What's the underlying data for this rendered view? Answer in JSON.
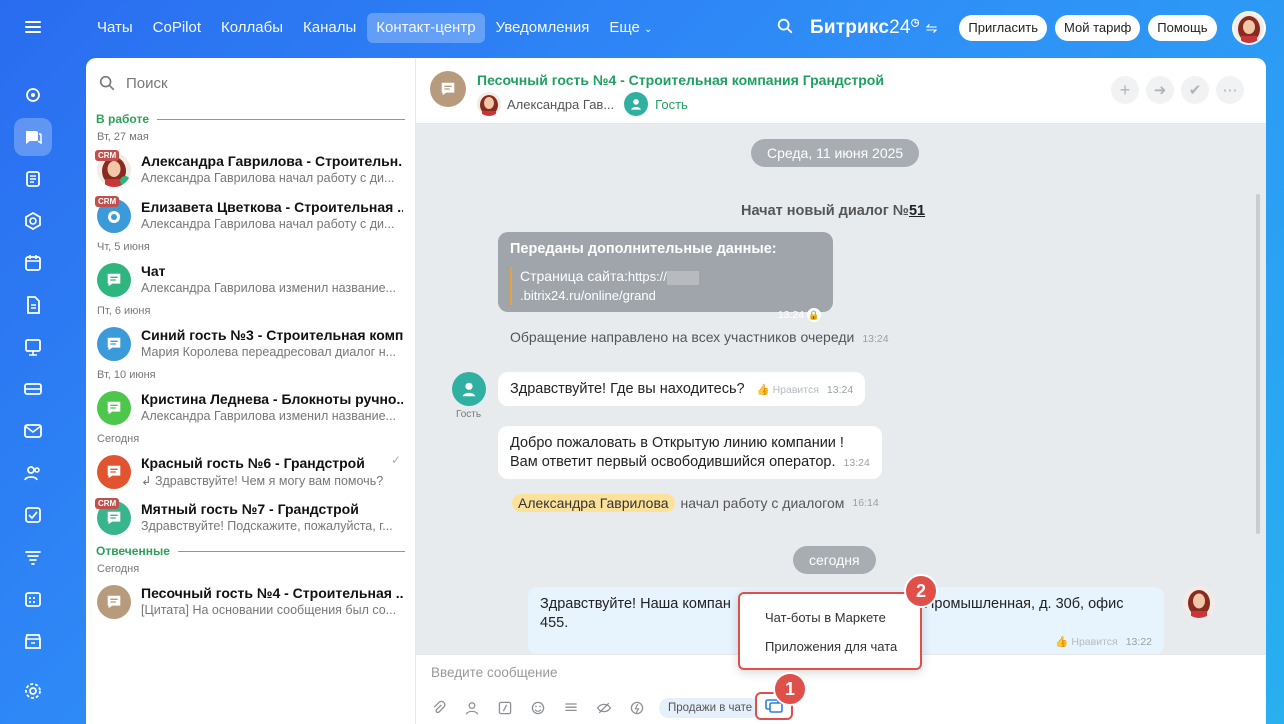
{
  "topnav": {
    "items": [
      "Чаты",
      "CoPilot",
      "Коллабы",
      "Каналы",
      "Контакт-центр",
      "Уведомления",
      "Еще"
    ],
    "active": "Контакт-центр"
  },
  "brand": {
    "name": "Битрикс",
    "num": "24"
  },
  "header_buttons": {
    "invite": "Пригласить",
    "tariff": "Мой тариф",
    "help": "Помощь"
  },
  "search": {
    "placeholder": "Поиск"
  },
  "list": {
    "section_work": "В работе",
    "section_answered": "Отвеченные",
    "dates": [
      "Вт, 27 мая",
      "Чт, 5 июня",
      "Пт, 6 июня",
      "Вт, 10 июня",
      "Сегодня",
      "Сегодня"
    ],
    "crm": "CRM",
    "items": [
      {
        "title": "Александра Гаврилова - Строительн...",
        "msg": "Александра Гаврилова начал работу с ди...",
        "color": "#ffffff"
      },
      {
        "title": "Елизавета Цветкова - Строительная ...",
        "msg": "Александра Гаврилова начал работу с ди...",
        "color": "#3b9ad9"
      },
      {
        "title": "Чат",
        "msg": "Александра Гаврилова изменил название...",
        "color": "#2fb57f"
      },
      {
        "title": "Синий гость №3 - Строительная комп...",
        "msg": "Мария Королева переадресовал диалог н...",
        "color": "#3b9ad9"
      },
      {
        "title": "Кристина Леднева - Блокноты ручно...",
        "msg": "Александра Гаврилова изменил название...",
        "color": "#4cc74c"
      },
      {
        "title": "Красный гость №6 - Грандстрой",
        "msg": "Здравствуйте! Чем я могу вам помочь?",
        "color": "#e2532f"
      },
      {
        "title": "Мятный гость №7 - Грандстрой",
        "msg": "Здравствуйте! Подскажите, пожалуйста, г...",
        "color": "#38b58c"
      },
      {
        "title": "Песочный гость №4 - Строительная ...",
        "msg": "[Цитата] На основании сообщения был со...",
        "color": "#b89a7c"
      }
    ]
  },
  "chat": {
    "title": "Песочный гость №4 - Строительная компания Грандстрой",
    "operator": "Александра Гав...",
    "guest": "Гость",
    "date1": "Среда, 11 июня 2025",
    "new_dialog": "Начат новый диалог №",
    "new_dialog_num": "51",
    "extra_title": "Переданы дополнительные данные:",
    "extra_label": "Страница сайта:",
    "extra_url1": "https://",
    "extra_url2": ".bitrix24.ru/online/grand",
    "t1324": "13:24",
    "t1622": "13:22",
    "t1614": "16:14",
    "sent_all": "Обращение направлено на всех участников очереди",
    "hello_q": "Здравствуйте! Где вы находитесь?",
    "like": "Нравится",
    "guest_label": "Гость",
    "welcome1": "Добро пожаловать в Открытую линию компании !",
    "welcome2": "Вам ответит первый освободившийся оператор.",
    "operator_full": "Александра Гаврилова",
    "started": "начал работу с диалогом",
    "today": "сегодня",
    "reply1": "Здравствуйте! Наша компан",
    "reply1b": "Промышленная, д. 30б, офис",
    "reply2": "455."
  },
  "input": {
    "placeholder": "Введите сообщение",
    "sales": "Продажи в чате"
  },
  "popup": {
    "item1": "Чат-боты в Маркете",
    "item2": "Приложения для чата"
  },
  "badges": {
    "one": "1",
    "two": "2"
  }
}
